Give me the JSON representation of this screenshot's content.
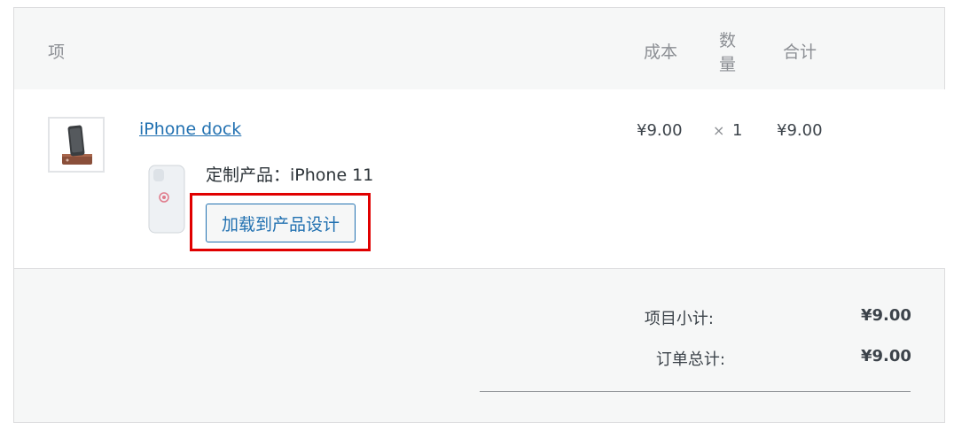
{
  "table": {
    "headers": {
      "item": "项",
      "cost": "成本",
      "qty_line1": "数",
      "qty_line2": "量",
      "total": "合计"
    }
  },
  "line_item": {
    "product_name": "iPhone dock",
    "cost": "¥9.00",
    "qty_sign": "×",
    "qty": "1",
    "total": "¥9.00",
    "meta_label": "定制产品：iPhone 11",
    "load_button": "加载到产品设计"
  },
  "totals": {
    "subtotal_label": "项目小计:",
    "subtotal_value": "¥9.00",
    "order_total_label": "订单总计:",
    "order_total_value": "¥9.00"
  },
  "colors": {
    "link": "#2271b1",
    "highlight": "#e00000",
    "panel_bg": "#f6f7f7"
  }
}
